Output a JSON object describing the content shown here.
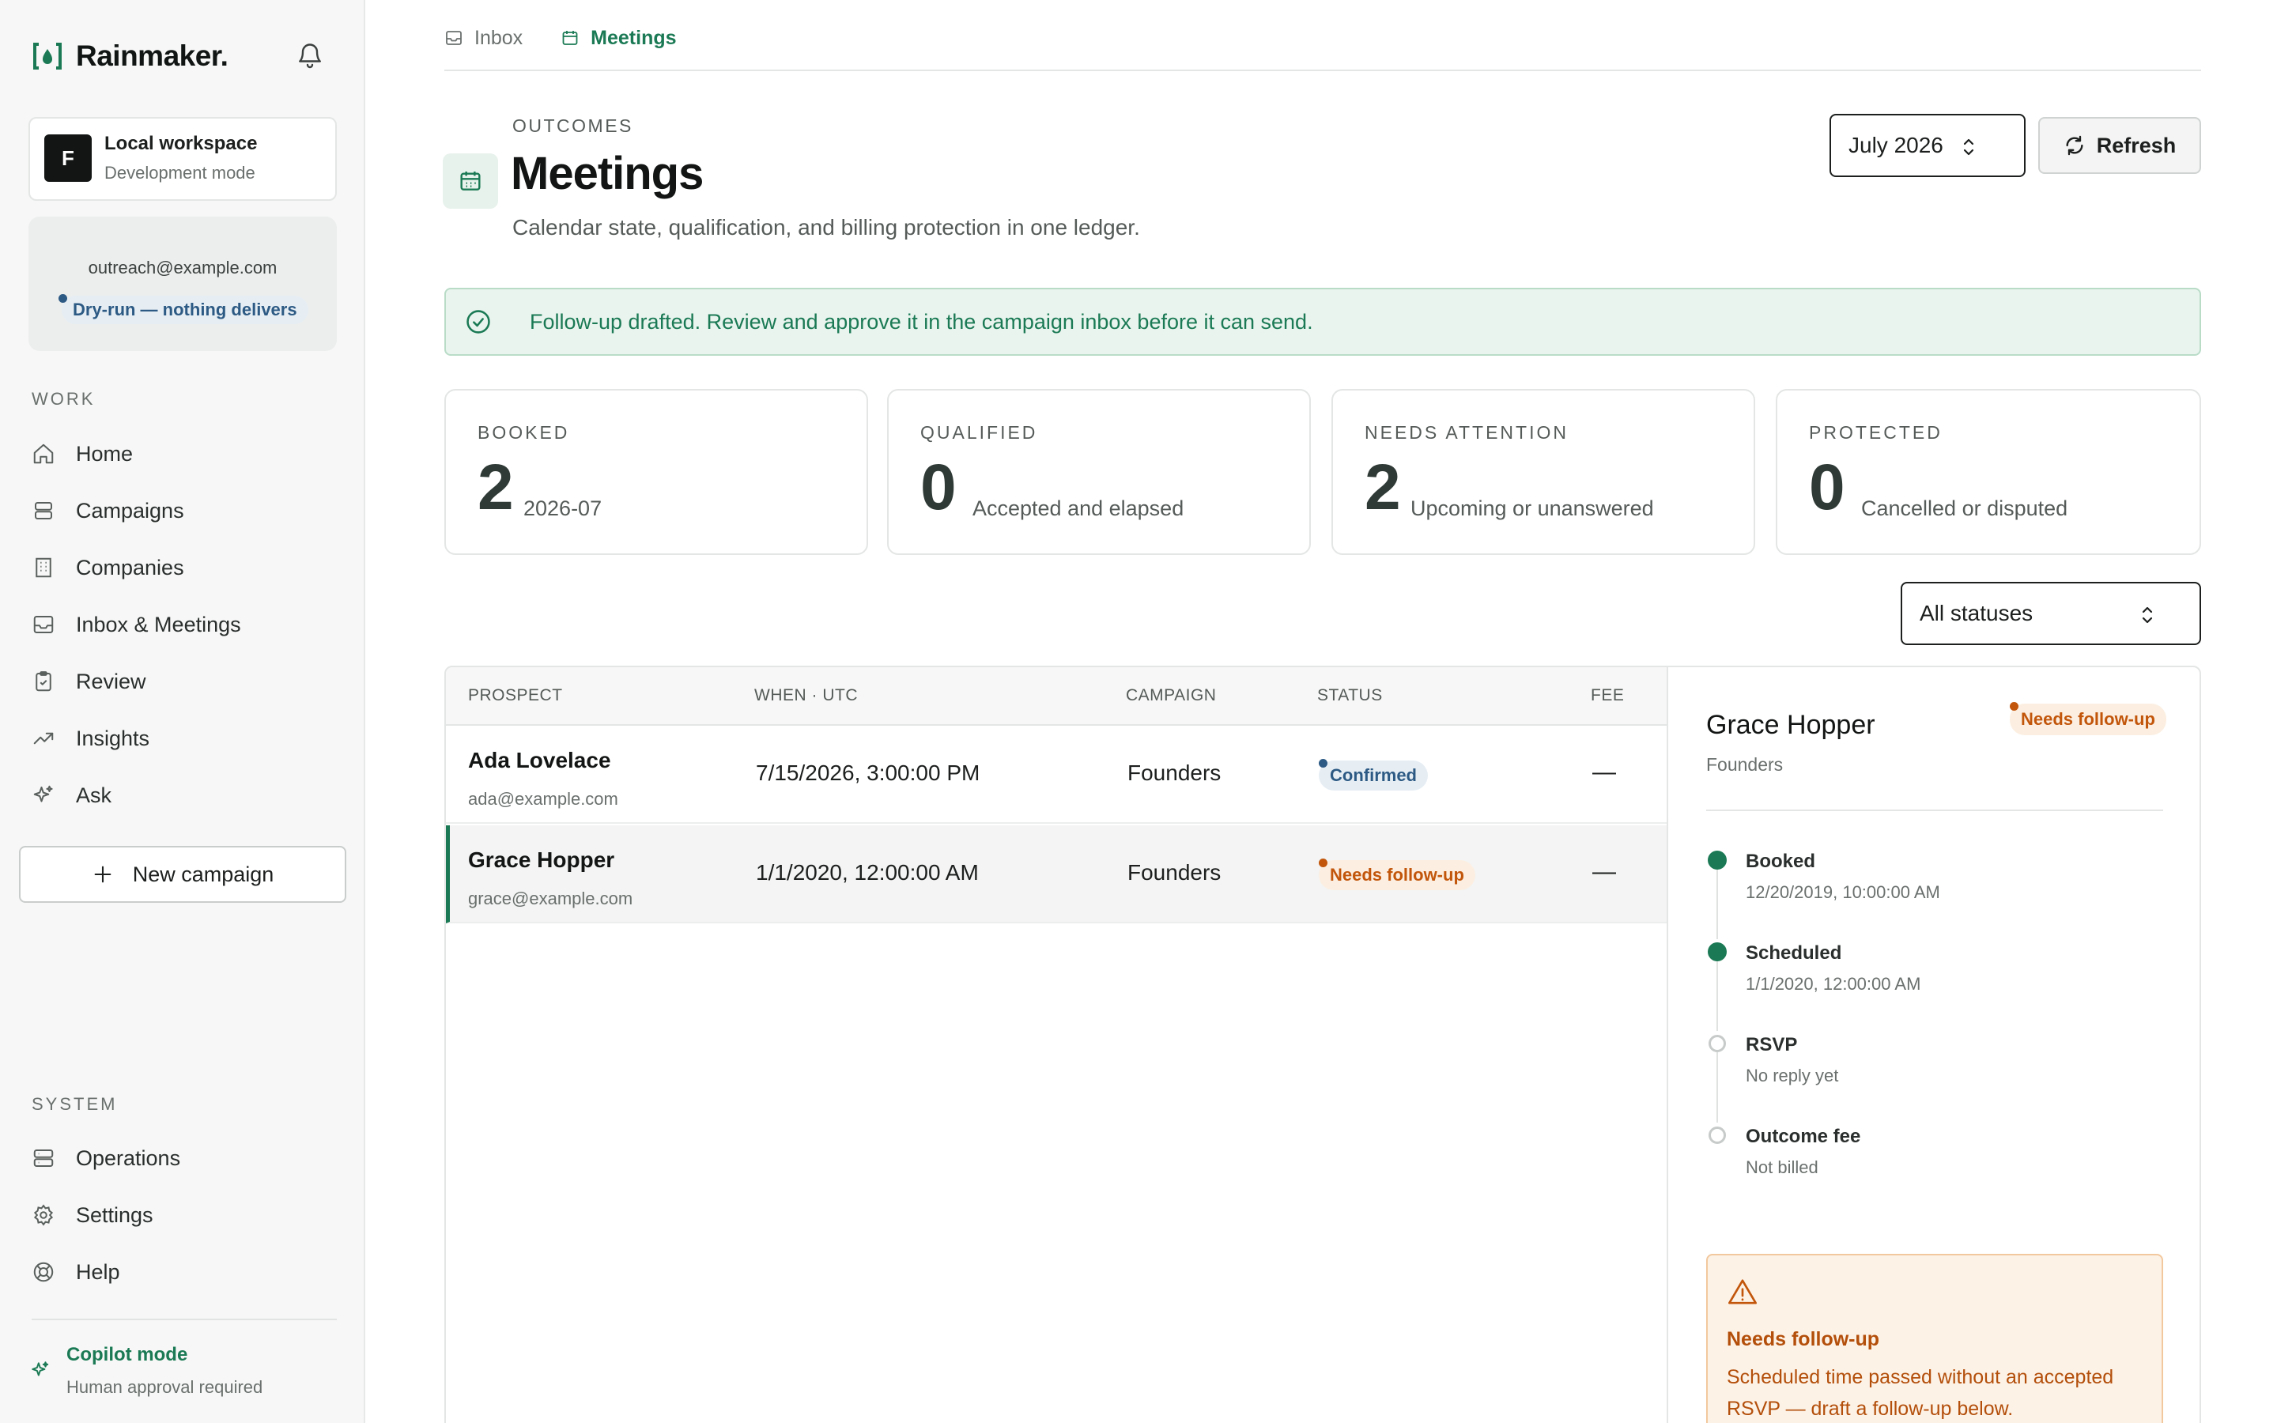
{
  "sidebar": {
    "brand": "Rainmaker.",
    "workspace": {
      "initial": "F",
      "name": "Local workspace",
      "mode": "Development mode"
    },
    "account": {
      "email": "outreach@example.com",
      "status": "Dry-run — nothing delivers"
    },
    "work_section": "WORK",
    "work_items": [
      {
        "label": "Home",
        "icon": "home-icon"
      },
      {
        "label": "Campaigns",
        "icon": "layers-icon"
      },
      {
        "label": "Companies",
        "icon": "building-icon"
      },
      {
        "label": "Inbox & Meetings",
        "icon": "inbox-icon"
      },
      {
        "label": "Review",
        "icon": "clipboard-check-icon"
      },
      {
        "label": "Insights",
        "icon": "trending-up-icon"
      },
      {
        "label": "Ask",
        "icon": "sparkles-icon"
      }
    ],
    "new_campaign": "New campaign",
    "system_section": "SYSTEM",
    "system_items": [
      {
        "label": "Operations",
        "icon": "server-icon"
      },
      {
        "label": "Settings",
        "icon": "gear-icon"
      },
      {
        "label": "Help",
        "icon": "lifebuoy-icon"
      }
    ],
    "copilot": {
      "title": "Copilot mode",
      "subtitle": "Human approval required"
    }
  },
  "breadcrumbs": [
    {
      "label": "Inbox",
      "icon": "inbox-icon",
      "active": false
    },
    {
      "label": "Meetings",
      "icon": "calendar-icon",
      "active": true
    }
  ],
  "header": {
    "eyebrow": "OUTCOMES",
    "title": "Meetings",
    "subtitle": "Calendar state, qualification, and billing protection in one ledger.",
    "month": "July 2026",
    "refresh": "Refresh"
  },
  "alert": "Follow-up drafted. Review and approve it in the campaign inbox before it can send.",
  "stats": [
    {
      "label": "BOOKED",
      "value": "2",
      "desc": "2026-07"
    },
    {
      "label": "QUALIFIED",
      "value": "0",
      "desc": "Accepted and elapsed"
    },
    {
      "label": "NEEDS ATTENTION",
      "value": "2",
      "desc": "Upcoming or unanswered"
    },
    {
      "label": "PROTECTED",
      "value": "0",
      "desc": "Cancelled or disputed"
    }
  ],
  "status_filter": "All statuses",
  "table": {
    "columns": [
      "PROSPECT",
      "WHEN · UTC",
      "CAMPAIGN",
      "STATUS",
      "FEE"
    ],
    "rows": [
      {
        "name": "Ada Lovelace",
        "email": "ada@example.com",
        "when": "7/15/2026, 3:00:00 PM",
        "campaign": "Founders",
        "status": "Confirmed",
        "fee": "—"
      },
      {
        "name": "Grace Hopper",
        "email": "grace@example.com",
        "when": "1/1/2020, 12:00:00 AM",
        "campaign": "Founders",
        "status": "Needs follow-up",
        "fee": "—"
      }
    ]
  },
  "detail": {
    "name": "Grace Hopper",
    "campaign": "Founders",
    "status": "Needs follow-up",
    "timeline": [
      {
        "title": "Booked",
        "sub": "12/20/2019, 10:00:00 AM",
        "done": true
      },
      {
        "title": "Scheduled",
        "sub": "1/1/2020, 12:00:00 AM",
        "done": true
      },
      {
        "title": "RSVP",
        "sub": "No reply yet",
        "done": false
      },
      {
        "title": "Outcome fee",
        "sub": "Not billed",
        "done": false
      }
    ],
    "warning": {
      "title": "Needs follow-up",
      "text": "Scheduled time passed without an accepted RSVP — draft a follow-up below."
    }
  },
  "colors": {
    "accent": "#1b7a55",
    "info": "#2d5a84",
    "warning": "#c2560b"
  }
}
